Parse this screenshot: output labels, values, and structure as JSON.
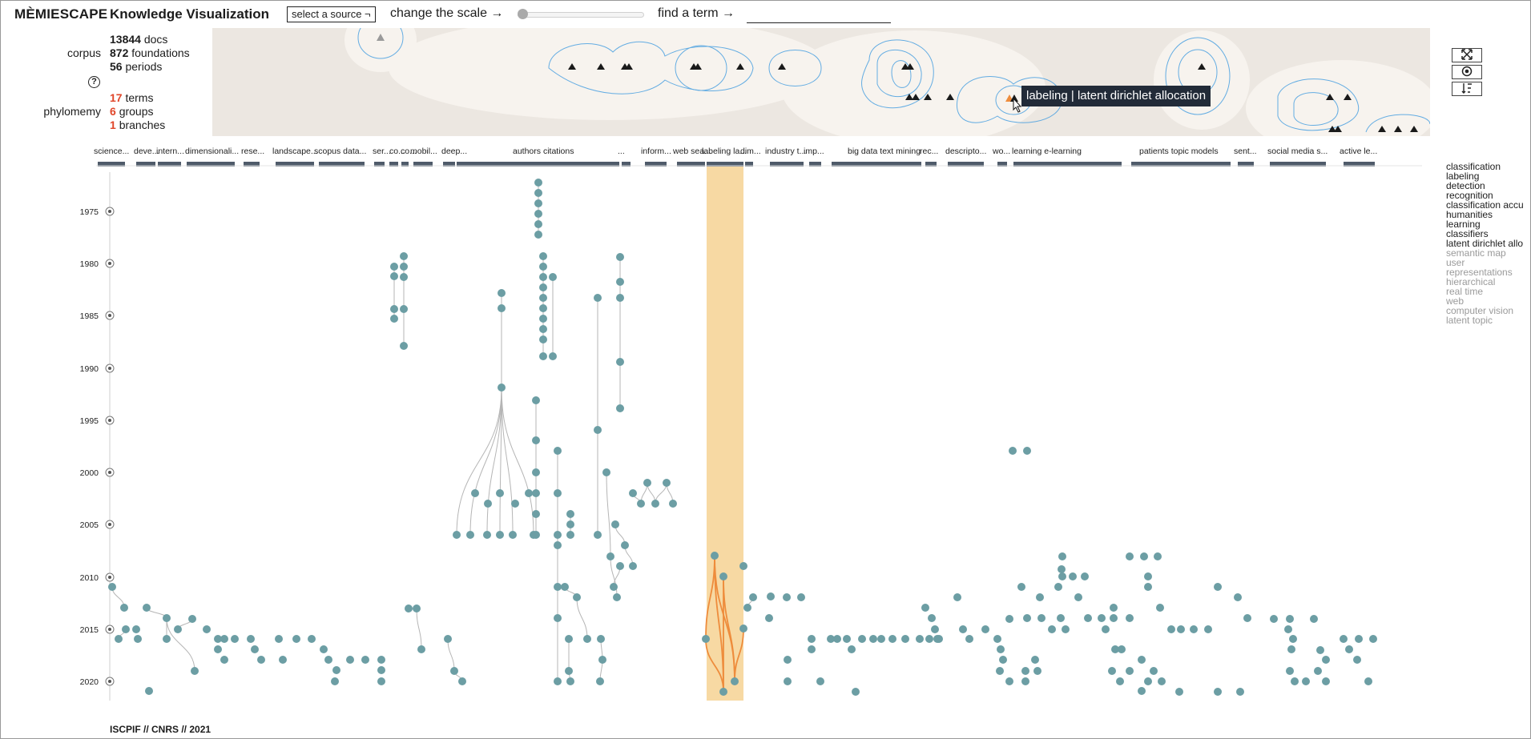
{
  "header": {
    "brand": "MÈMIESCAPE",
    "title": "Knowledge Visualization",
    "source_button": "select a source ¬",
    "scale_label": "change the scale →",
    "scale_value": 0,
    "find_label": "find a term →",
    "find_value": ""
  },
  "stats": {
    "corpus_label": "corpus",
    "docs_count": "13844",
    "docs_label": "docs",
    "foundations_count": "872",
    "foundations_label": "foundations",
    "periods_count": "56",
    "periods_label": "periods",
    "help_symbol": "?",
    "phylomemy_label": "phylomemy",
    "terms_count": "17",
    "terms_label": "terms",
    "groups_count": "6",
    "groups_label": "groups",
    "branches_count": "1",
    "branches_label": "branches"
  },
  "tooltip": "labeling | latent dirichlet allocation",
  "tools": {
    "fit_icon": "expand-icon",
    "center_icon": "target-icon",
    "sort_icon": "sort-icon"
  },
  "colors": {
    "node": "#6c9ea4",
    "edge": "#b5b5b5",
    "highlight_band": "#f7d9a3",
    "highlight_edge": "#ee8c3c",
    "branch_bar": "#4f5b6a",
    "accent_red": "#e0462a",
    "landscape_bg": "#ece7e1",
    "contour": "#4aa0e0"
  },
  "branch_labels": [
    "science...",
    "deve...",
    "intern...",
    "dimensionali...",
    "rese...",
    "landscape...",
    "scopus data...",
    "ser...",
    "co...",
    "co...",
    "mobil...",
    "deep...",
    "authors citations",
    "...",
    "inform...",
    "web sea...",
    "labeling la...",
    "dim...",
    "industry t...",
    "imp...",
    "big data text mining",
    "rec...",
    "descripto...",
    "wo...",
    "learning e-learning",
    "patients topic models",
    "sent...",
    "social media s...",
    "active le..."
  ],
  "years": [
    "1975",
    "1980",
    "1985",
    "1990",
    "1995",
    "2000",
    "2005",
    "2010",
    "2015",
    "2020"
  ],
  "legend_terms": [
    {
      "label": "classification",
      "active": true
    },
    {
      "label": "labeling",
      "active": true
    },
    {
      "label": "detection",
      "active": true
    },
    {
      "label": "recognition",
      "active": true
    },
    {
      "label": "classification accu",
      "active": true
    },
    {
      "label": "humanities",
      "active": true
    },
    {
      "label": "learning",
      "active": true
    },
    {
      "label": "classifiers",
      "active": true
    },
    {
      "label": "latent dirichlet allo",
      "active": true
    },
    {
      "label": "semantic map",
      "active": false
    },
    {
      "label": "user",
      "active": false
    },
    {
      "label": "representations",
      "active": false
    },
    {
      "label": "hierarchical",
      "active": false
    },
    {
      "label": "real time",
      "active": false
    },
    {
      "label": "web",
      "active": false
    },
    {
      "label": "computer vision",
      "active": false
    },
    {
      "label": "latent topic",
      "active": false
    }
  ],
  "footer": "ISCPIF // CNRS // 2021"
}
